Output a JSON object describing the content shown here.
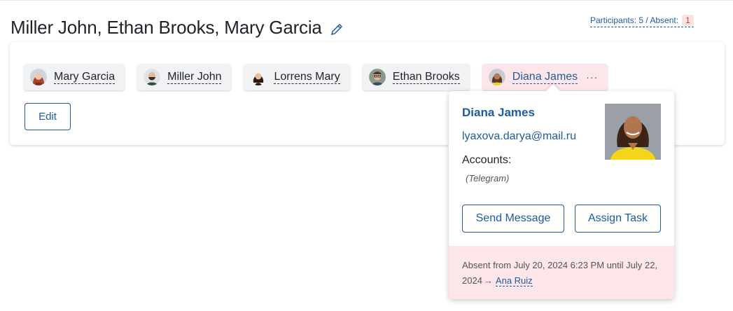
{
  "header": {
    "title": "Miller John, Ethan Brooks, Mary Garcia",
    "participants_label": "Participants: 5 / Absent:",
    "absent_count": "1"
  },
  "participants": [
    {
      "name": "Mary Garcia",
      "icon": "avatar-woman-red-hair"
    },
    {
      "name": "Miller John",
      "icon": "avatar-man-beard"
    },
    {
      "name": "Lorrens Mary",
      "icon": "avatar-woman-curly-hair"
    },
    {
      "name": "Ethan Brooks",
      "icon": "avatar-man-glasses"
    },
    {
      "name": "Diana James",
      "icon": "avatar-woman-yellow",
      "more": "···"
    }
  ],
  "edit_label": "Edit",
  "popup": {
    "name": "Diana James",
    "email": "lyaxova.darya@mail.ru",
    "accounts_label": "Accounts:",
    "telegram": "(Telegram)",
    "send_message": "Send Message",
    "assign_task": "Assign Task",
    "absence_text": "Absent from July 20, 2024 6:23 PM until July 22, 2024",
    "absence_arrow": "→",
    "deputy": "Ana Ruiz"
  },
  "colors": {
    "accent": "#1d5c9e",
    "absent_bg": "#fde6ea",
    "absent_badge": "#c43a3a"
  }
}
